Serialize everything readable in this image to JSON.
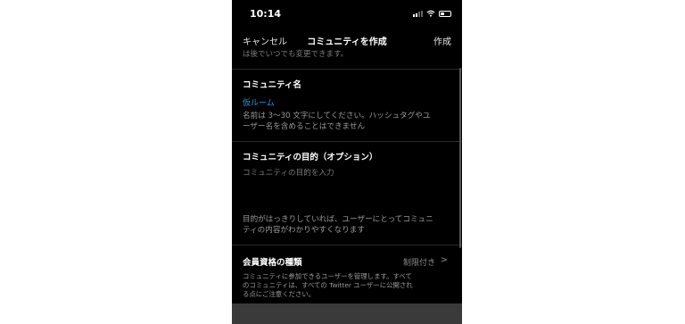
{
  "status": {
    "time": "10:14"
  },
  "nav": {
    "cancel": "キャンセル",
    "title": "コミュニティを作成",
    "create": "作成"
  },
  "faded_top": "は後でいつでも変更できます。",
  "name_section": {
    "title": "コミュニティ名",
    "value": "仮ルーム",
    "help_line1": "名前は 3〜30 文字にしてください。ハッシュタグやユ",
    "help_line2": "ーザー名を含めることはできません"
  },
  "purpose_section": {
    "title": "コミュニティの目的（オプション）",
    "placeholder": "コミュニティの目的を入力",
    "help_line1": "目的がはっきりしていれば、ユーザーにとってコミュニ",
    "help_line2": "ティの内容がわかりやすくなります"
  },
  "membership": {
    "label": "会員資格の種類",
    "value": "制限付き",
    "chevron": ">",
    "help_line1": "コミュニティに参加できるユーザーを管理します。すべて",
    "help_line2": "のコミュニティは、すべての Twitter ユーザーに公開され",
    "help_line3": "る点にご注意ください。"
  },
  "icons": [
    "signal-icon",
    "wifi-icon",
    "battery-icon",
    "chevron-right-icon"
  ],
  "colors": {
    "background": "#000000",
    "accent": "#1d9bf0",
    "text": "#ffffff",
    "secondary": "#9a9a9a"
  }
}
